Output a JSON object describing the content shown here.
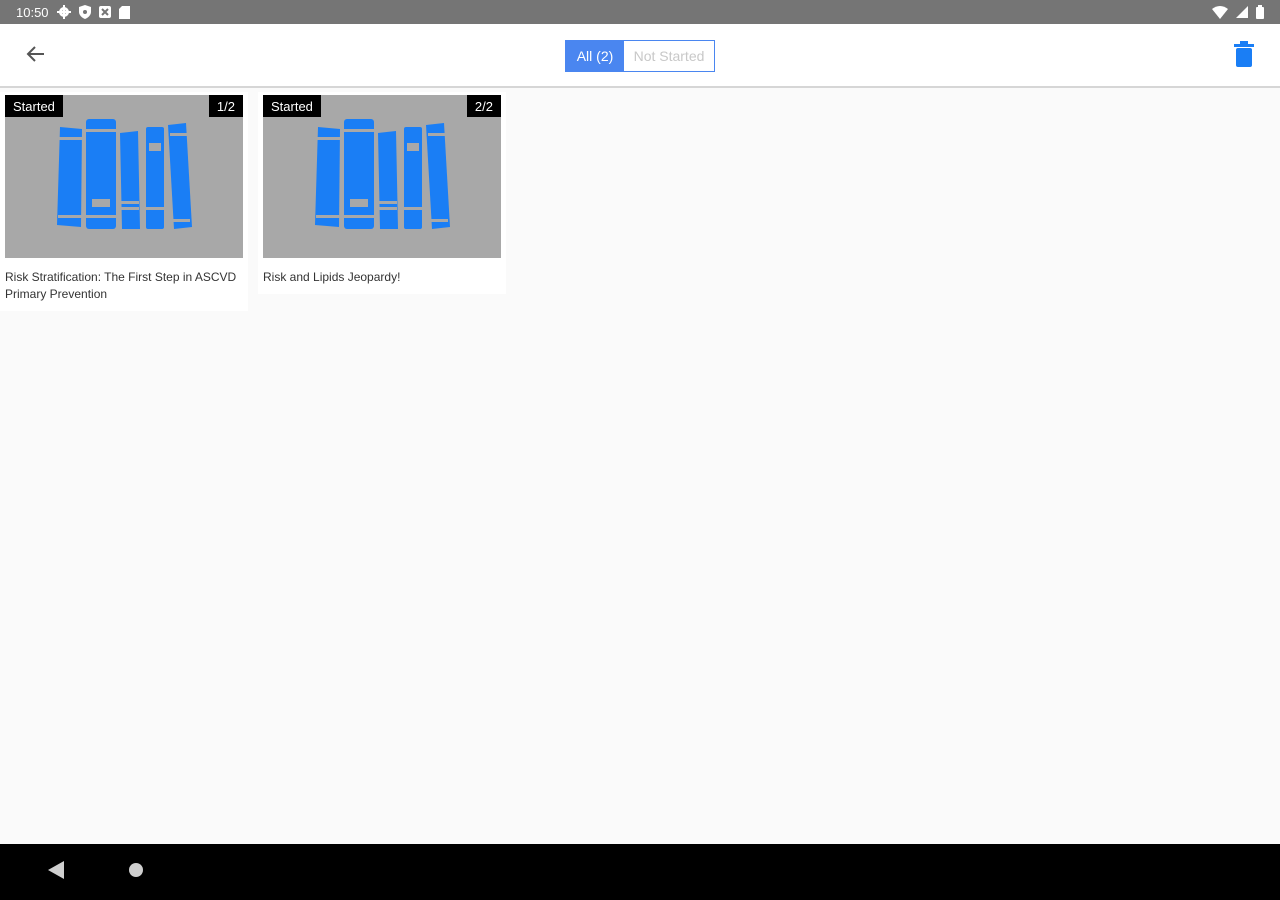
{
  "status_bar": {
    "time": "10:50",
    "left_icons": [
      "gear-icon",
      "shield-icon",
      "notification-icon",
      "sd-card-icon"
    ],
    "right_icons": [
      "wifi-icon",
      "signal-icon",
      "battery-icon"
    ]
  },
  "toolbar": {
    "filters": [
      {
        "label": "All (2)",
        "selected": true
      },
      {
        "label": "Not Started",
        "selected": false
      }
    ]
  },
  "colors": {
    "accent": "#4a86f0",
    "icon_blue": "#1a7ef5",
    "thumb_bg": "#a8a8a8"
  },
  "cards": [
    {
      "status": "Started",
      "progress": "1/2",
      "title": "Risk Stratification: The First Step in ASCVD Primary Prevention",
      "thumbnail_icon": "books-icon"
    },
    {
      "status": "Started",
      "progress": "2/2",
      "title": "Risk and Lipids Jeopardy!",
      "thumbnail_icon": "books-icon"
    }
  ]
}
